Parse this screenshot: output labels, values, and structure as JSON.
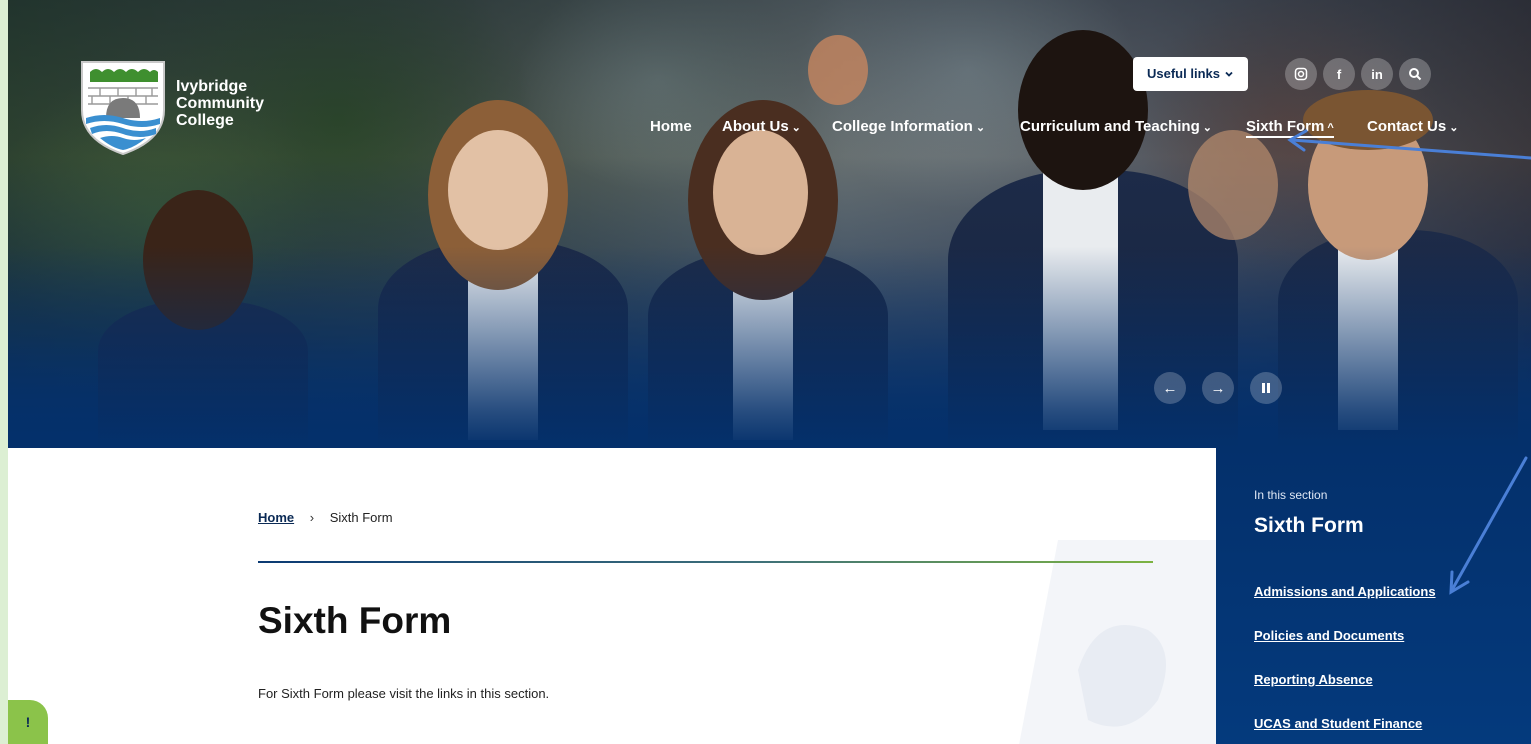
{
  "brand": {
    "name_line1": "Ivybridge",
    "name_line2": "Community",
    "name_line3": "College"
  },
  "header": {
    "useful_links": "Useful links",
    "social": [
      "instagram-icon",
      "facebook-icon",
      "linkedin-icon",
      "search-icon"
    ],
    "social_glyphs": {
      "facebook": "f",
      "linkedin": "in"
    },
    "nav": [
      {
        "label": "Home",
        "has_dropdown": false
      },
      {
        "label": "About Us",
        "has_dropdown": true
      },
      {
        "label": "College Information",
        "has_dropdown": true
      },
      {
        "label": "Curriculum and Teaching",
        "has_dropdown": true
      },
      {
        "label": "Sixth Form",
        "has_dropdown": true,
        "active": true
      },
      {
        "label": "Contact Us",
        "has_dropdown": true
      }
    ]
  },
  "hero": {
    "controls": [
      "previous-icon",
      "next-icon",
      "pause-icon"
    ]
  },
  "breadcrumb": {
    "home": "Home",
    "separator": "›",
    "current": "Sixth Form"
  },
  "main": {
    "title": "Sixth Form",
    "intro": "For Sixth Form please visit the links in this section."
  },
  "sidebar": {
    "label": "In this section",
    "title": "Sixth Form",
    "links": [
      "Admissions and Applications",
      "Policies and Documents",
      "Reporting Absence",
      "UCAS and Student Finance"
    ]
  },
  "feedback": {
    "label": "!"
  },
  "colors": {
    "navy": "#04306b",
    "accent_green": "#8bc34a",
    "annotation_arrow": "#4a7fd6"
  }
}
